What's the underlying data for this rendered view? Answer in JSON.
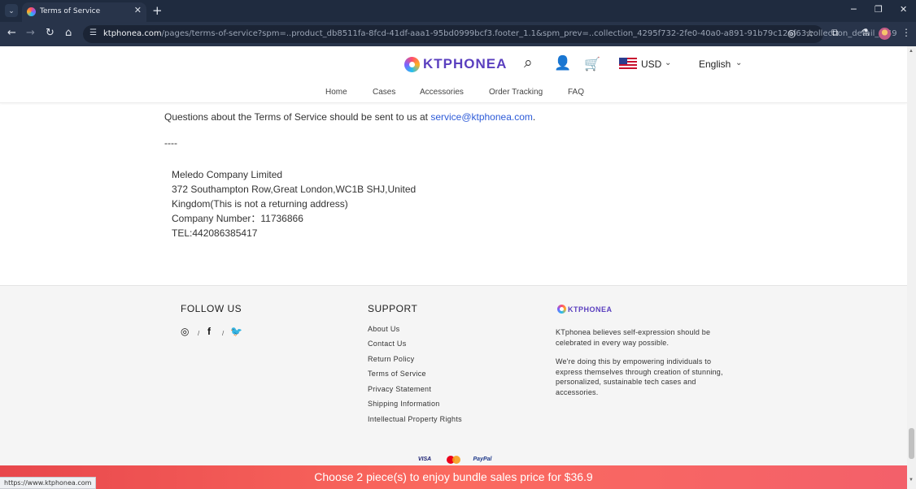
{
  "browser": {
    "tab_title": "Terms of Service",
    "url_host": "ktphonea.com",
    "url_path": "/pages/terms-of-service?spm=..product_db8511fa-8fcd-41df-aaa1-95bd0999bcf3.footer_1.1&spm_prev=..collection_4295f732-2fe0-40a0-a891-91b79c126f63.collection_detail_1.49",
    "status_url": "https://www.ktphonea.com"
  },
  "header": {
    "logo_text": "KTPHONEA",
    "currency": "USD",
    "language": "English",
    "nav": [
      "Home",
      "Cases",
      "Accessories",
      "Order Tracking",
      "FAQ"
    ]
  },
  "content": {
    "question_prefix": "Questions about the Terms of Service should be sent to us at ",
    "email": "service@ktphonea.com",
    "question_suffix": ".",
    "separator": "----",
    "address_lines": [
      "Meledo Company Limited",
      "372 Southampton Row,Great London,WC1B SHJ,United",
      "Kingdom(This is not a returning address)",
      "Company Number：11736866",
      "TEL:442086385417"
    ]
  },
  "footer": {
    "follow_title": "FOLLOW US",
    "social_sep": "/",
    "support_title": "SUPPORT",
    "support_links": [
      "About Us",
      "Contact Us",
      "Return Policy",
      "Terms of Service",
      "Privacy Statement",
      "Shipping Information",
      "Intellectual Property Rights"
    ],
    "brand_logo_text": "KTPHONEA",
    "about_p1": "KTphonea believes self-expression should be celebrated in every way possible.",
    "about_p2": "We're doing this by empowering individuals to express themselves through creation of stunning, personalized, sustainable tech cases and accessories.",
    "payments": {
      "visa": "VISA",
      "paypal": "PayPal"
    }
  },
  "promo": {
    "text": "Choose 2 piece(s) to enjoy bundle sales price for $36.9"
  },
  "icons": [
    "tab-search-icon",
    "favicon-icon",
    "close-icon",
    "plus-icon",
    "minimize-icon",
    "maximize-icon",
    "back-icon",
    "forward-icon",
    "reload-icon",
    "home-icon",
    "site-info-icon",
    "eye-off-icon",
    "star-icon",
    "extensions-icon",
    "labs-icon",
    "menu-icon",
    "search-icon",
    "user-icon",
    "cart-icon",
    "chevron-down-icon",
    "instagram-icon",
    "facebook-icon",
    "twitter-icon"
  ],
  "colors": {
    "accent": "#5a3fbf",
    "link": "#2d5bd8",
    "promo": "#f3606a"
  }
}
